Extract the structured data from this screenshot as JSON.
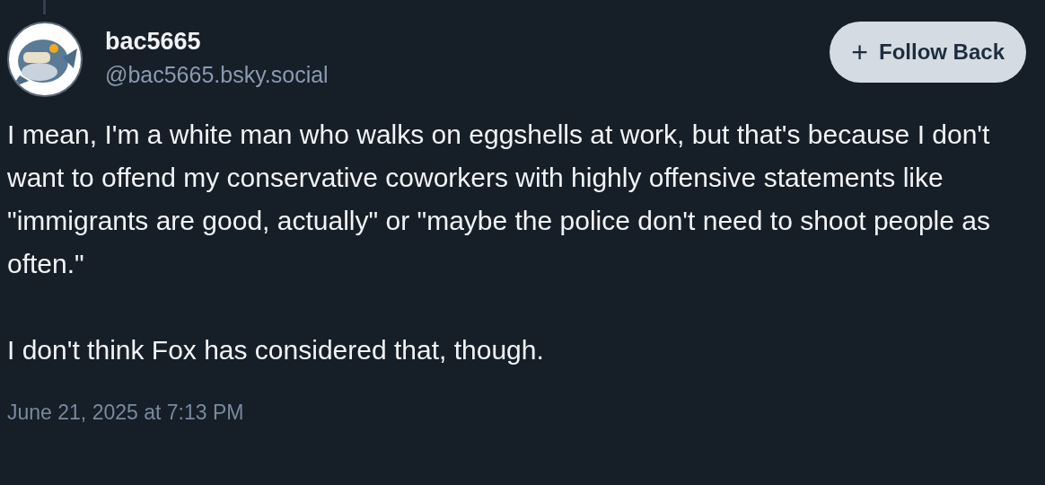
{
  "author": {
    "display_name": "bac5665",
    "handle": "@bac5665.bsky.social"
  },
  "follow_button": {
    "icon": "+",
    "label": "Follow Back"
  },
  "post": {
    "paragraphs": [
      "I mean, I'm a white man who walks on eggshells at work, but that's because I don't want to offend my conservative coworkers with highly offensive statements like \"immigrants are good, actually\" or \"maybe the police don't need to shoot people as often.\"",
      "I don't think Fox has considered that, though."
    ],
    "timestamp": "June 21, 2025 at 7:13 PM"
  }
}
